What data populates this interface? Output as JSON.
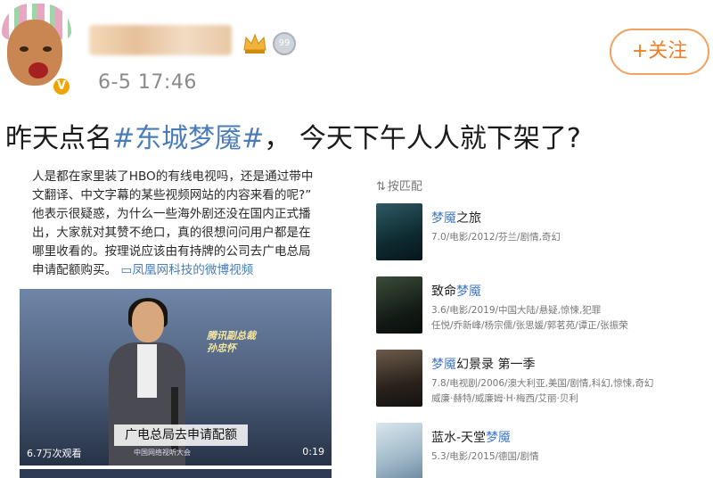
{
  "header": {
    "timestamp": "6-5 17:46",
    "follow_label": "+关注",
    "verified_badge": "V",
    "medal_label": "99"
  },
  "post": {
    "text_before": "昨天点名",
    "hashtag": "#东城梦魇#",
    "text_after": "， 今天下午人人就下架了?"
  },
  "article": {
    "lines": [
      "人是都在家里装了HBO的有线电视吗，还是通过带中",
      "文翻译、中文字幕的某些视频网站的内容来看的呢?”",
      "他表示很疑惑，为什么一些海外剧还没在国内正式播",
      "出，大家就对其赞不绝口，真的很想问问用户都是在",
      "哪里收看的。按理说应该由有持牌的公司去广电总局",
      "申请配额购买。"
    ],
    "source": "凤凰网科技的微博视频",
    "video": {
      "title_card_line1": "腾讯副总裁",
      "title_card_line2": "孙忠怀",
      "caption": "广电总局去申请配额",
      "subcaption": "中国网络视听大会",
      "views": "6.7万次观看",
      "duration": "0:19"
    }
  },
  "results": {
    "sort_label": "按匹配",
    "items": [
      {
        "title_hl": "梦魇",
        "title_rest": "之旅",
        "meta1": "7.0/电影/2012/芬兰/剧情,奇幻",
        "meta2": ""
      },
      {
        "title_pre": "致命",
        "title_hl": "梦魇",
        "meta1": "3.6/电影/2019/中国大陆/悬疑,惊悚,犯罪",
        "meta2": "任悦/乔新峰/杨宗儒/张思媛/郭茗苑/谭正/张振荣"
      },
      {
        "title_hl": "梦魇",
        "title_rest": "幻景录 第一季",
        "meta1": "7.8/电视剧/2006/澳大利亚,美国/剧情,科幻,惊悚,奇幻",
        "meta2": "威廉·赫特/威廉姆·H·梅西/艾丽·贝利"
      },
      {
        "title_pre": "蓝水-天堂",
        "title_hl": "梦魇",
        "meta1": "5.3/电影/2015/德国/剧情",
        "meta2": ""
      }
    ]
  }
}
